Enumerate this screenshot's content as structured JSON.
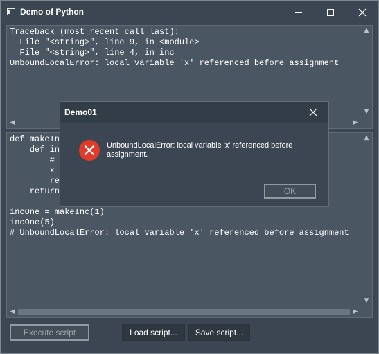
{
  "window": {
    "title": "Demo of Python",
    "icons": {
      "app": "window-icon",
      "minimize": "minimize-icon",
      "maximize": "maximize-icon",
      "close": "close-icon"
    }
  },
  "output": {
    "text": "Traceback (most recent call last):\n  File \"<string>\", line 9, in <module>\n  File \"<string>\", line 4, in inc\nUnboundLocalError: local variable 'x' referenced before assignment"
  },
  "code": {
    "text": "def makeInc\n    def inc\n        # I\n        x +\n        ret\n    return\n\nincOne = makeInc(1)\nincOne(5)\n# UnboundLocalError: local variable 'x' referenced before assignment"
  },
  "buttons": {
    "execute": "Execute script",
    "load": "Load script...",
    "save": "Save script..."
  },
  "dialog": {
    "title": "Demo01",
    "message": "UnboundLocalError: local variable 'x' referenced before assignment.",
    "ok": "OK",
    "icon": "error-icon"
  },
  "colors": {
    "background": "#3b4652",
    "pane": "#4a5661",
    "error": "#e03a2a"
  }
}
